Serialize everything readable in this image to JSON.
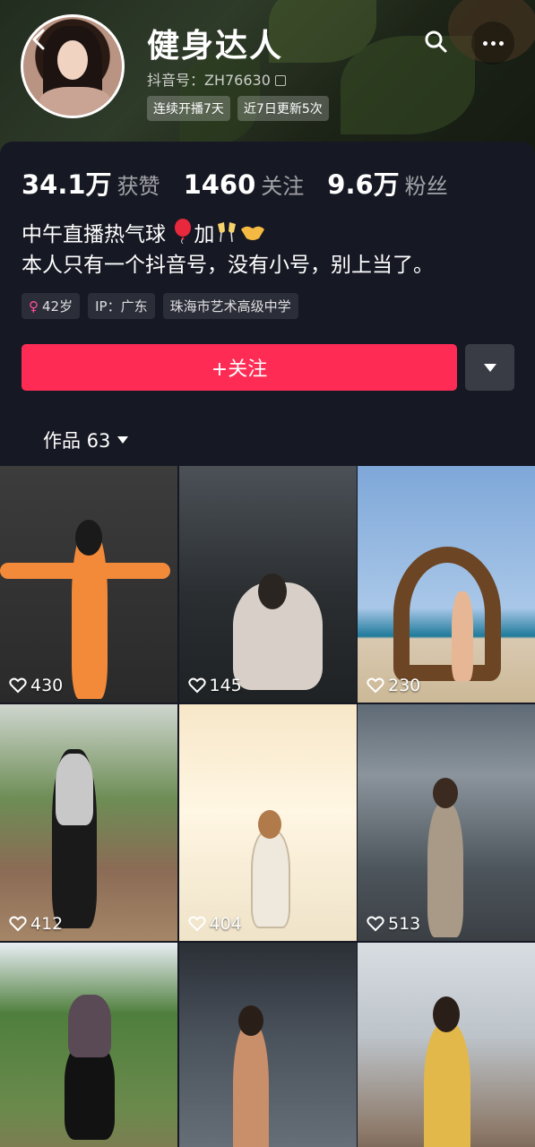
{
  "profile": {
    "name": "健身达人",
    "douyin_id": "抖音号：ZH76630",
    "badges": [
      "连续开播7天",
      "近7日更新5次"
    ],
    "stats": {
      "likes_num": "34.1万",
      "likes_label": "获赞",
      "following_num": "1460",
      "following_label": "关注",
      "followers_num": "9.6万",
      "followers_label": "粉丝"
    },
    "bio_line1": "中午直播热气球",
    "bio_line1_mid": "加",
    "bio_line2": "本人只有一个抖音号，没有小号，别上当了。",
    "tags": {
      "age": "42岁",
      "ip": "IP：广东",
      "school": "珠海市艺术高级中学"
    }
  },
  "actions": {
    "follow_label": "+关注"
  },
  "works_tab": {
    "label": "作品 63"
  },
  "videos": [
    {
      "likes": "430"
    },
    {
      "likes": "145"
    },
    {
      "likes": "230"
    },
    {
      "likes": "412"
    },
    {
      "likes": "404"
    },
    {
      "likes": "513"
    },
    {
      "likes": ""
    },
    {
      "likes": ""
    },
    {
      "likes": ""
    }
  ],
  "colors": {
    "background": "#161823",
    "follow_button": "#fe2c55",
    "tag_bg": "#2b2d38",
    "female_icon": "#ff4f9a"
  },
  "icons": [
    "back-icon",
    "search-icon",
    "more-icon",
    "copy-icon",
    "female-icon",
    "heart-icon",
    "chevron-down-icon",
    "balloon-icon",
    "cheers-icon",
    "handshake-icon"
  ]
}
